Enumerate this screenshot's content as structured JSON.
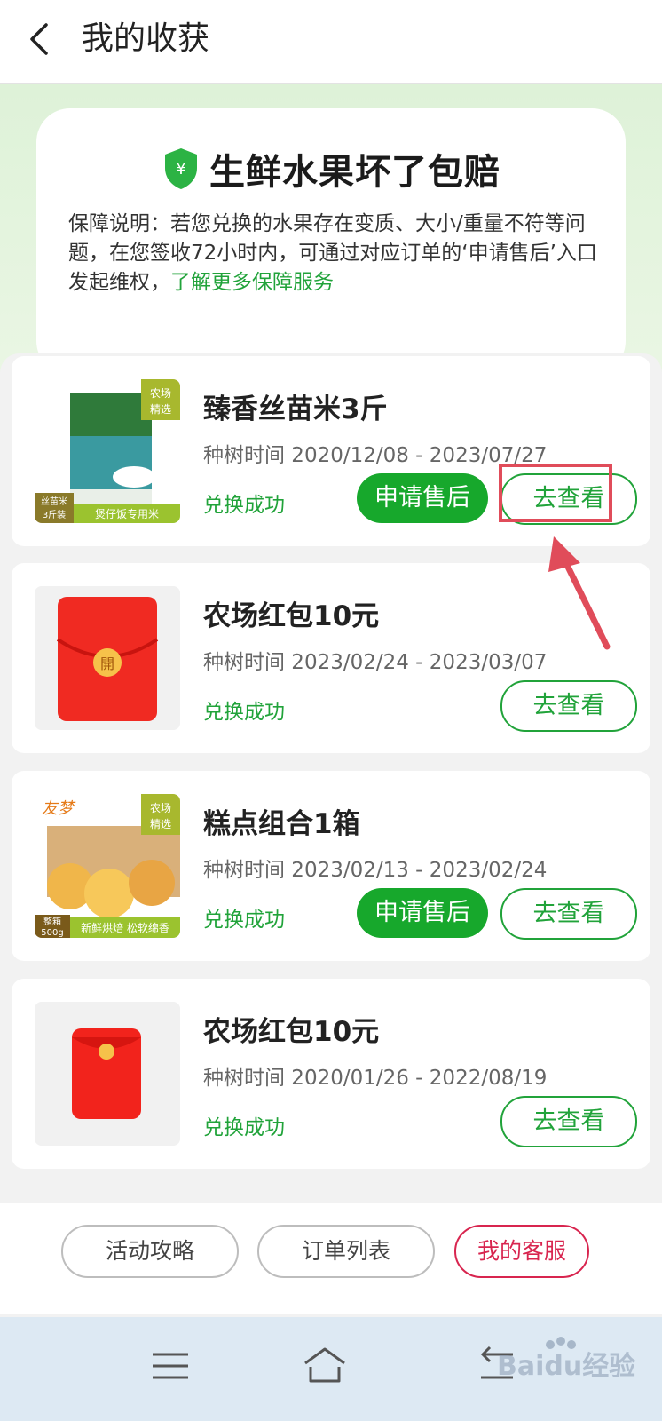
{
  "header": {
    "title": "我的收获"
  },
  "guarantee": {
    "title": "生鲜水果坏了包赔",
    "description": "保障说明：若您兑换的水果存在变质、大小/重量不符等问题，在您签收72小时内，可通过对应订单的‘申请售后’入口发起维权，",
    "link": "了解更多保障服务",
    "shield_symbol": "¥"
  },
  "items": [
    {
      "name": "臻香丝苗米3斤",
      "time": "种树时间 2020/12/08 - 2023/07/27",
      "status": "兑换成功",
      "after_sale_label": "申请售后",
      "view_label": "去查看",
      "thumb_tag": "农场精选",
      "thumb_corner": "丝苗米3斤装",
      "thumb_caption": "煲仔饭专用米"
    },
    {
      "name": "农场红包10元",
      "time": "种树时间 2023/02/24 - 2023/03/07",
      "status": "兑换成功",
      "view_label": "去查看",
      "thumb_glyph": "開"
    },
    {
      "name": "糕点组合1箱",
      "time": "种树时间 2023/02/13 - 2023/02/24",
      "status": "兑换成功",
      "after_sale_label": "申请售后",
      "view_label": "去查看",
      "thumb_tag": "农场精选",
      "thumb_brand": "友梦",
      "thumb_corner": "整箱500g",
      "thumb_caption": "新鲜烘焙 松软绵香"
    },
    {
      "name": "农场红包10元",
      "time": "种树时间 2020/01/26 - 2022/08/19",
      "status": "兑换成功",
      "view_label": "去查看"
    }
  ],
  "bottom": {
    "guide": "活动攻略",
    "orders": "订单列表",
    "service": "我的客服"
  },
  "watermark": "Baidu经验",
  "colors": {
    "accent_green": "#21a33a",
    "button_green": "#17a82c",
    "service_red": "#d8254f",
    "annotation_red": "#e04c5a"
  },
  "icons": [
    "back-icon",
    "shield-icon",
    "menu-icon",
    "home-icon",
    "return-icon"
  ]
}
